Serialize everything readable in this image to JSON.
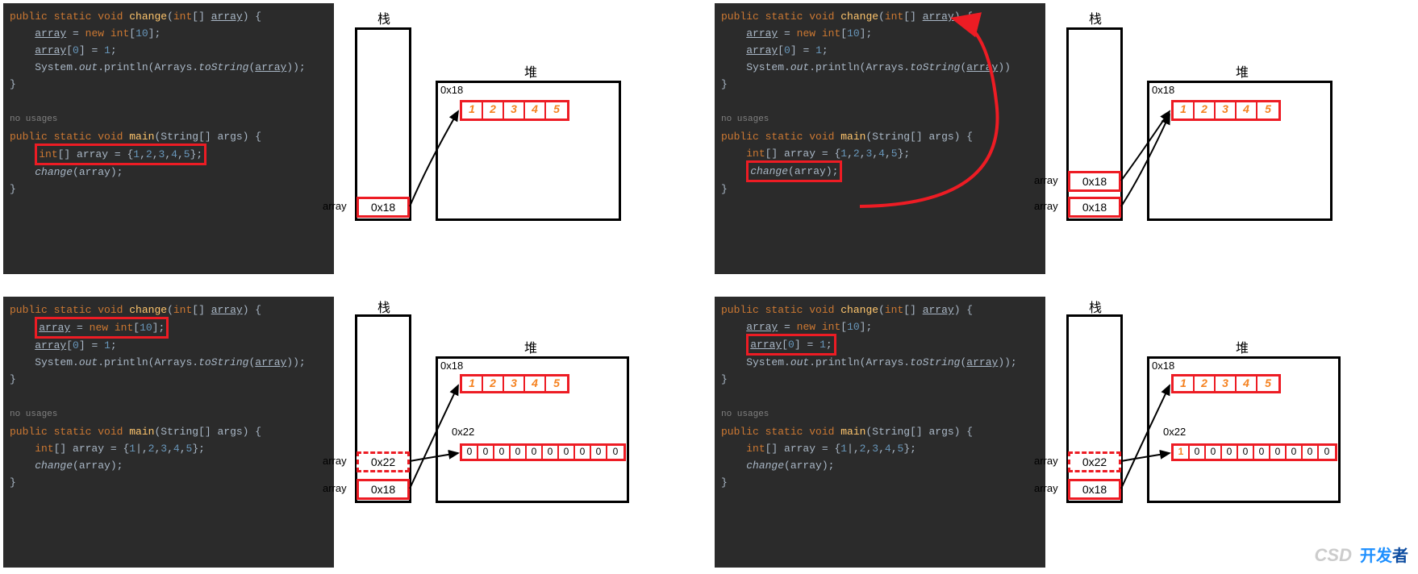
{
  "labels": {
    "stack": "栈",
    "heap": "堆",
    "no_usages": "no usages",
    "array_side": "array"
  },
  "addresses": {
    "addr1": "0x18",
    "addr2": "0x22"
  },
  "code": {
    "change_sig_open": "public static void change(int[] array) {",
    "change_l1": "array = new int[10];",
    "change_l2": "array[0] = 1;",
    "change_l3_a": "System.out.println(Arrays.toString(array));",
    "change_l3_b": "System.out.println(Arrays.toString(array))",
    "close": "}",
    "main_sig": "public static void main(String[] args) {",
    "main_l1_full": "int[] array = {1,2,3,4,5};",
    "main_l1_caret": "int[] array = {1|,2,3,4,5};",
    "main_l2": "change(array);"
  },
  "array_data": {
    "initial": [
      "1",
      "2",
      "3",
      "4",
      "5"
    ],
    "zeros": [
      "0",
      "0",
      "0",
      "0",
      "0",
      "0",
      "0",
      "0",
      "0",
      "0"
    ],
    "one_zeros": [
      "1",
      "0",
      "0",
      "0",
      "0",
      "0",
      "0",
      "0",
      "0",
      "0"
    ]
  },
  "watermark": {
    "a": "开发",
    "b": "者",
    "csd": "CSD"
  }
}
